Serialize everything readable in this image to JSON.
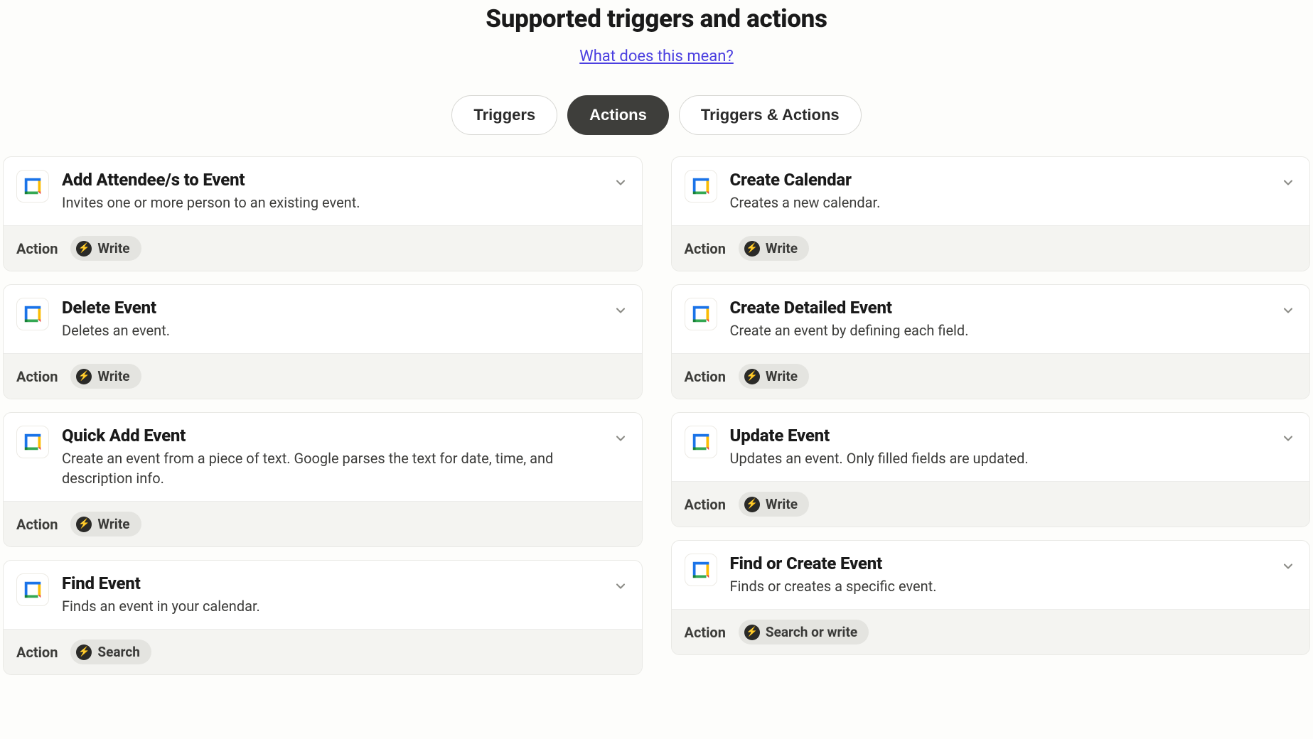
{
  "header": {
    "title": "Supported triggers and actions",
    "help_link": "What does this mean?"
  },
  "filters": {
    "triggers": "Triggers",
    "actions": "Actions",
    "both": "Triggers & Actions",
    "active": "actions"
  },
  "labels": {
    "action": "Action"
  },
  "left_cards": [
    {
      "title": "Add Attendee/s to Event",
      "desc": "Invites one or more person to an existing event.",
      "badge": "Write"
    },
    {
      "title": "Delete Event",
      "desc": "Deletes an event.",
      "badge": "Write"
    },
    {
      "title": "Quick Add Event",
      "desc": "Create an event from a piece of text. Google parses the text for date, time, and description info.",
      "badge": "Write"
    },
    {
      "title": "Find Event",
      "desc": "Finds an event in your calendar.",
      "badge": "Search"
    }
  ],
  "right_cards": [
    {
      "title": "Create Calendar",
      "desc": "Creates a new calendar.",
      "badge": "Write"
    },
    {
      "title": "Create Detailed Event",
      "desc": "Create an event by defining each field.",
      "badge": "Write"
    },
    {
      "title": "Update Event",
      "desc": "Updates an event. Only filled fields are updated.",
      "badge": "Write"
    },
    {
      "title": "Find or Create Event",
      "desc": "Finds or creates a specific event.",
      "badge": "Search or write"
    }
  ]
}
